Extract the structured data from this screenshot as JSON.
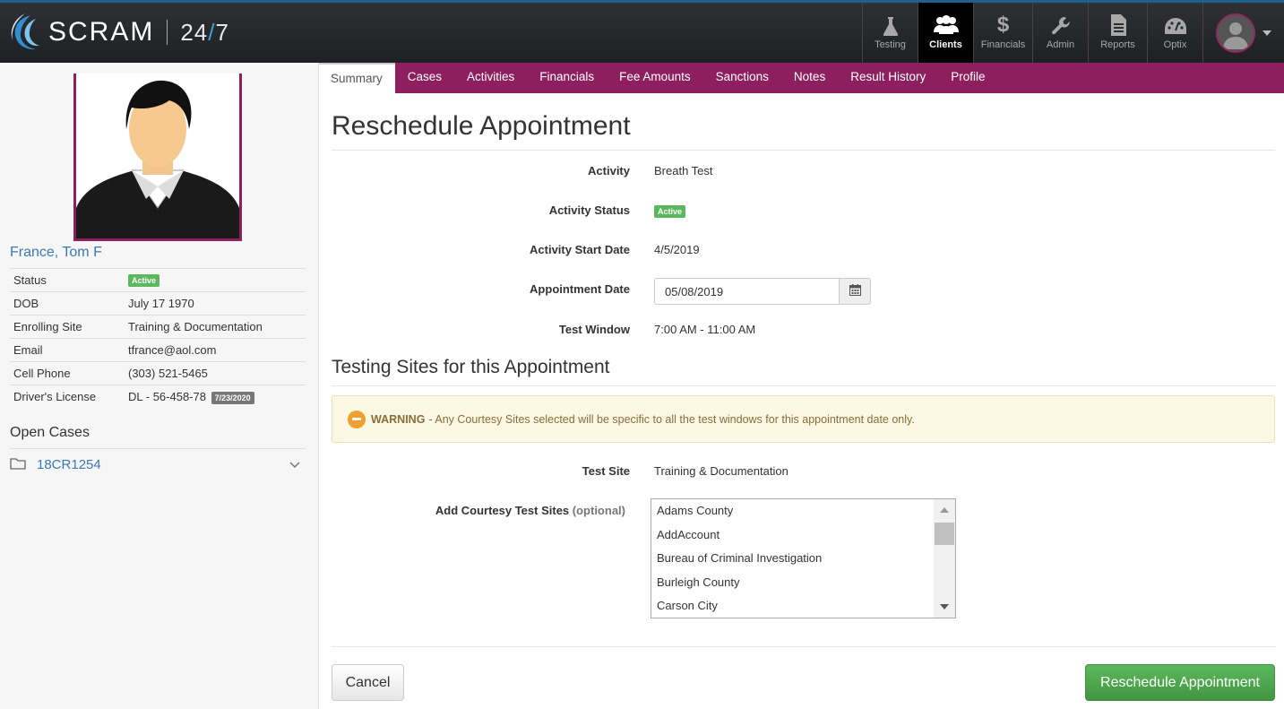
{
  "brand": {
    "name": "SCRAM",
    "product_pre": "24",
    "product_slash": "/",
    "product_post": "7"
  },
  "topnav": {
    "items": [
      {
        "label": "Testing",
        "icon": "flask-icon"
      },
      {
        "label": "Clients",
        "icon": "users-icon",
        "active": true
      },
      {
        "label": "Financials",
        "icon": "dollar-icon"
      },
      {
        "label": "Admin",
        "icon": "wrench-icon"
      },
      {
        "label": "Reports",
        "icon": "document-icon"
      },
      {
        "label": "Optix",
        "icon": "dashboard-icon"
      }
    ]
  },
  "subnav": {
    "tabs": [
      "Summary",
      "Cases",
      "Activities",
      "Financials",
      "Fee Amounts",
      "Sanctions",
      "Notes",
      "Result History",
      "Profile"
    ],
    "active": "Summary"
  },
  "client": {
    "name": "France, Tom F",
    "fields": [
      {
        "label": "Status",
        "value": "",
        "badge": "Active"
      },
      {
        "label": "DOB",
        "value": "July 17 1970"
      },
      {
        "label": "Enrolling Site",
        "value": "Training & Documentation"
      },
      {
        "label": "Email",
        "value": "tfrance@aol.com"
      },
      {
        "label": "Cell Phone",
        "value": "(303) 521-5465"
      },
      {
        "label": "Driver's License",
        "value": "DL - 56-458-78",
        "date_badge": "7/23/2020"
      }
    ],
    "open_cases_title": "Open Cases",
    "cases": [
      "18CR1254"
    ]
  },
  "main": {
    "title": "Reschedule Appointment",
    "activity_label": "Activity",
    "activity_value": "Breath Test",
    "activity_status_label": "Activity Status",
    "activity_status_badge": "Active",
    "start_date_label": "Activity Start Date",
    "start_date_value": "4/5/2019",
    "appointment_date_label": "Appointment Date",
    "appointment_date_value": "05/08/2019",
    "test_window_label": "Test Window",
    "test_window_value": "7:00 AM - 11:00 AM",
    "section_title": "Testing Sites for this Appointment",
    "warning_strong": "WARNING",
    "warning_text": "- Any Courtesy Sites selected will be specific to all the test windows for this appointment date only.",
    "test_site_label": "Test Site",
    "test_site_value": "Training & Documentation",
    "courtesy_label": "Add Courtesy Test Sites",
    "courtesy_optional": "(optional)",
    "courtesy_options": [
      "Adams County",
      "AddAccount",
      "Bureau of Criminal Investigation",
      "Burleigh County",
      "Carson City"
    ],
    "cancel_label": "Cancel",
    "submit_label": "Reschedule Appointment"
  },
  "colors": {
    "brand_maroon": "#8e1f5e",
    "link_blue": "#3a7ab7",
    "success_green": "#5cb85c",
    "warning_bg": "#fcf8e3"
  }
}
